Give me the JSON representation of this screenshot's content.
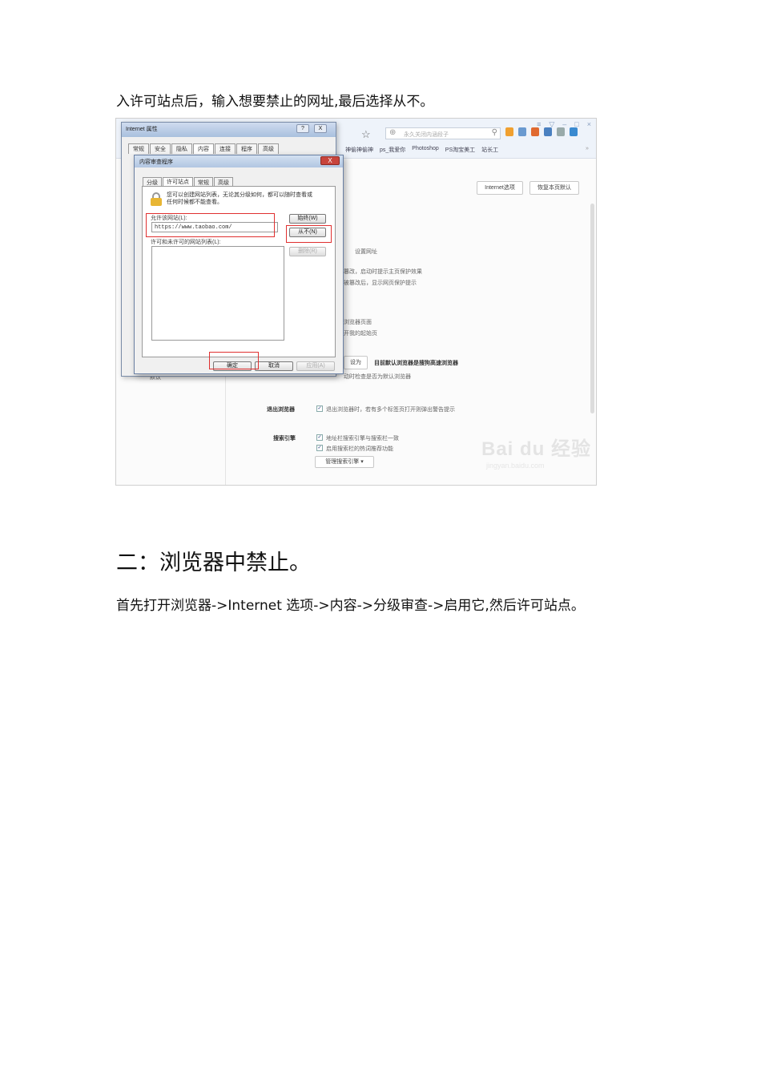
{
  "paragraph_1": "入许可站点后，输入想要禁止的网址,最后选择从不。",
  "heading_2": "二：浏览器中禁止。",
  "paragraph_2": "首先打开浏览器->Internet 选项->内容->分级审查->启用它,然后许可站点。",
  "screenshot": {
    "browser": {
      "address_placeholder": "永久关闭内涵段子",
      "bookmarks": [
        "神偷神偷神",
        "ps_我爱你",
        "Photoshop",
        "PS淘宝美工",
        "站长工"
      ],
      "window_controls": [
        "≡",
        "▽",
        "–",
        "□",
        "×"
      ],
      "toolbar_icon_colors": [
        "#f0a030",
        "#6a9ad0",
        "#e06a30",
        "#4a80c0",
        "#9aa",
        "#3a8ad0"
      ]
    },
    "settings": {
      "internet_options_button": "Internet选项",
      "restore_home_button": "恢复本页默认",
      "frag_set_url": "设置网址",
      "frag_line1": "篡改，启动时提示主页保护效果",
      "frag_line2": "被篡改后，显示网页保护提示",
      "frag_line3": "浏览器页面",
      "frag_line4": "开我的起始页",
      "frag_button": "设为",
      "default_browser_text": "目前默认浏览器是搜狗高速浏览器",
      "default_browser_sub": "动时检查是否为默认浏览器",
      "left_label": "默认",
      "exit_label": "退出浏览器",
      "exit_text": "退出浏览器时，若有多个标签页打开则弹出警告提示",
      "search_label": "搜索引擎",
      "search_opt1": "地址栏搜索引擎与搜索栏一致",
      "search_opt2": "启用搜索栏的热词推荐功能",
      "manage_search_button": "管理搜索引擎",
      "watermark": "Bai du 经验",
      "watermark_url": "jingyan.baidu.com"
    },
    "internet_options": {
      "title": "Internet 属性",
      "help": "?",
      "close": "X",
      "tabs": [
        "常规",
        "安全",
        "隐私",
        "内容",
        "连接",
        "程序",
        "高级"
      ],
      "active_tab": 3
    },
    "content_advisor": {
      "title": "内容审查程序",
      "close": "X",
      "tabs": [
        "分级",
        "许可站点",
        "常规",
        "高级"
      ],
      "active_tab": 1,
      "description_line1": "您可以创建网站列表，无论其分级如何，都可以随时查看或",
      "description_line2": "任何时候都不能查看。",
      "allow_label": "允许该网站(L):",
      "site_value": "https://www.taobao.com/",
      "always_button": "始终(W)",
      "never_button": "从不(N)",
      "list_label": "许可和未许可的网站列表(L):",
      "remove_button": "删除(R)",
      "ok_button": "确定",
      "cancel_button": "取消",
      "apply_button": "应用(A)"
    }
  }
}
